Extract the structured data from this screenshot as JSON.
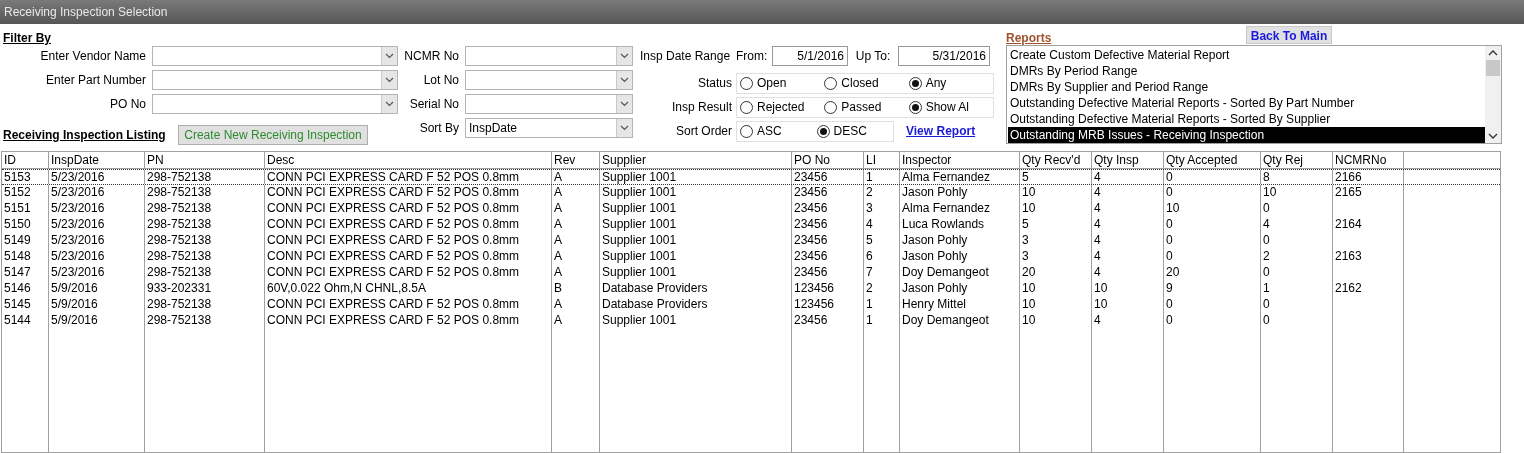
{
  "window": {
    "title": "Receiving Inspection Selection"
  },
  "filter": {
    "heading": "Filter By",
    "combos_left": [
      {
        "label": "Enter Vendor Name"
      },
      {
        "label": "Enter Part Number"
      },
      {
        "label": "PO No"
      }
    ],
    "combos_mid": [
      {
        "label": "NCMR No"
      },
      {
        "label": "Lot No"
      },
      {
        "label": "Serial No"
      },
      {
        "label": "Sort By",
        "value": "InspDate"
      }
    ],
    "date_range": {
      "label": "Insp Date Range",
      "from_label": "From:",
      "from": "5/1/2016",
      "to_label": "Up To:",
      "to": "5/31/2016"
    },
    "radio_groups": [
      {
        "label": "Status",
        "options": [
          {
            "label": "Open",
            "selected": false
          },
          {
            "label": "Closed",
            "selected": false
          },
          {
            "label": "Any",
            "selected": true
          }
        ]
      },
      {
        "label": "Insp Result",
        "options": [
          {
            "label": "Rejected",
            "selected": false
          },
          {
            "label": "Passed",
            "selected": false
          },
          {
            "label": "Show Al",
            "selected": true
          }
        ]
      },
      {
        "label": "Sort Order",
        "options": [
          {
            "label": "ASC",
            "selected": false
          },
          {
            "label": "DESC",
            "selected": true
          }
        ]
      }
    ],
    "view_report": "View Report"
  },
  "listing": {
    "heading": "Receiving Inspection Listing",
    "create_button": "Create New Receiving Inspection"
  },
  "reports": {
    "heading": "Reports",
    "back_button": "Back To Main",
    "items": [
      {
        "label": "Create Custom Defective Material Report",
        "selected": false
      },
      {
        "label": "DMRs By Period Range",
        "selected": false
      },
      {
        "label": "DMRs By Supplier and Period Range",
        "selected": false
      },
      {
        "label": "Outstanding Defective Material Reports - Sorted By Part Number",
        "selected": false
      },
      {
        "label": "Outstanding Defective Material Reports - Sorted By Supplier",
        "selected": false
      },
      {
        "label": "Outstanding MRB Issues - Receiving Inspection",
        "selected": true
      }
    ]
  },
  "table": {
    "columns": [
      "ID",
      "InspDate",
      "PN",
      "Desc",
      "Rev",
      "Supplier",
      "PO No",
      "LI",
      "Inspector",
      "Qty Recv'd",
      "Qty Insp",
      "Qty Accepted",
      "Qty Rej",
      "NCMRNo"
    ],
    "rows": [
      {
        "selected": true,
        "cells": [
          "5153",
          "5/23/2016",
          "298-752138",
          "CONN PCI EXPRESS CARD F 52 POS 0.8mm",
          "A",
          "Supplier 1001",
          "23456",
          "1",
          "Alma Fernandez",
          "5",
          "4",
          "0",
          "8",
          "2166"
        ]
      },
      {
        "selected": false,
        "cells": [
          "5152",
          "5/23/2016",
          "298-752138",
          "CONN PCI EXPRESS CARD F 52 POS 0.8mm",
          "A",
          "Supplier 1001",
          "23456",
          "2",
          "Jason Pohly",
          "10",
          "4",
          "0",
          "10",
          "2165"
        ]
      },
      {
        "selected": false,
        "cells": [
          "5151",
          "5/23/2016",
          "298-752138",
          "CONN PCI EXPRESS CARD F 52 POS 0.8mm",
          "A",
          "Supplier 1001",
          "23456",
          "3",
          "Alma Fernandez",
          "10",
          "4",
          "10",
          "0"
        ]
      },
      {
        "selected": false,
        "cells": [
          "5150",
          "5/23/2016",
          "298-752138",
          "CONN PCI EXPRESS CARD F 52 POS 0.8mm",
          "A",
          "Supplier 1001",
          "23456",
          "4",
          "Luca Rowlands",
          "5",
          "4",
          "0",
          "4",
          "2164"
        ]
      },
      {
        "selected": false,
        "cells": [
          "5149",
          "5/23/2016",
          "298-752138",
          "CONN PCI EXPRESS CARD F 52 POS 0.8mm",
          "A",
          "Supplier 1001",
          "23456",
          "5",
          "Jason Pohly",
          "3",
          "4",
          "0",
          "0"
        ]
      },
      {
        "selected": false,
        "cells": [
          "5148",
          "5/23/2016",
          "298-752138",
          "CONN PCI EXPRESS CARD F 52 POS 0.8mm",
          "A",
          "Supplier 1001",
          "23456",
          "6",
          "Jason Pohly",
          "3",
          "4",
          "0",
          "2",
          "2163"
        ]
      },
      {
        "selected": false,
        "cells": [
          "5147",
          "5/23/2016",
          "298-752138",
          "CONN PCI EXPRESS CARD F 52 POS 0.8mm",
          "A",
          "Supplier 1001",
          "23456",
          "7",
          "Doy Demangeot",
          "20",
          "4",
          "20",
          "0"
        ]
      },
      {
        "selected": false,
        "cells": [
          "5146",
          "5/9/2016",
          "933-202331",
          "60V,0.022 Ohm,N CHNL,8.5A",
          "B",
          "Database Providers",
          "123456",
          "2",
          "Jason Pohly",
          "10",
          "10",
          "9",
          "1",
          "2162"
        ]
      },
      {
        "selected": false,
        "cells": [
          "5145",
          "5/9/2016",
          "298-752138",
          "CONN PCI EXPRESS CARD F 52 POS 0.8mm",
          "A",
          "Database Providers",
          "123456",
          "1",
          "Henry Mittel",
          "10",
          "10",
          "0",
          "0"
        ]
      },
      {
        "selected": false,
        "cells": [
          "5144",
          "5/9/2016",
          "298-752138",
          "CONN PCI EXPRESS CARD F 52 POS 0.8mm",
          "A",
          "Supplier 1001",
          "23456",
          "1",
          "Doy Demangeot",
          "10",
          "4",
          "0",
          "0"
        ]
      }
    ]
  }
}
